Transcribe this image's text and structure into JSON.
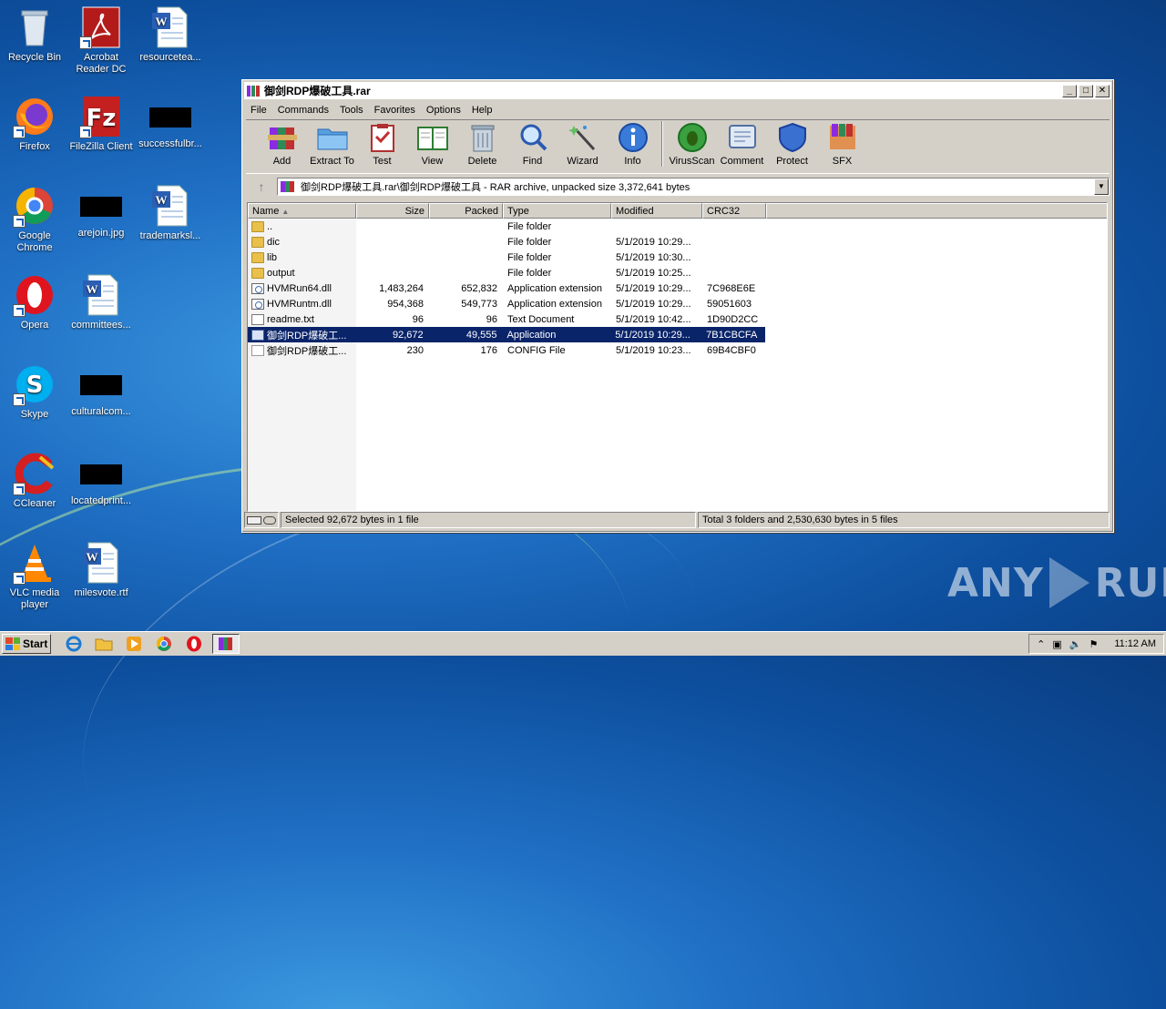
{
  "desktop": {
    "icons": [
      {
        "label": "Recycle Bin",
        "icon": "recycle-bin-icon"
      },
      {
        "label": "Acrobat Reader DC",
        "icon": "acrobat-icon"
      },
      {
        "label": "resourcetea...",
        "icon": "word-doc-icon"
      },
      {
        "label": "Firefox",
        "icon": "firefox-icon"
      },
      {
        "label": "FileZilla Client",
        "icon": "filezilla-icon"
      },
      {
        "label": "successfulbr...",
        "icon": "black-thumbnail-icon"
      },
      {
        "label": "Google Chrome",
        "icon": "chrome-icon"
      },
      {
        "label": "arejoin.jpg",
        "icon": "black-thumbnail-icon"
      },
      {
        "label": "trademarksl...",
        "icon": "word-doc-icon"
      },
      {
        "label": "Opera",
        "icon": "opera-icon"
      },
      {
        "label": "committees...",
        "icon": "word-doc-icon"
      },
      {
        "label": "Skype",
        "icon": "skype-icon"
      },
      {
        "label": "culturalcom...",
        "icon": "black-thumbnail-icon"
      },
      {
        "label": "CCleaner",
        "icon": "ccleaner-icon"
      },
      {
        "label": "locatedprint...",
        "icon": "black-thumbnail-icon"
      },
      {
        "label": "VLC media player",
        "icon": "vlc-icon"
      },
      {
        "label": "milesvote.rtf",
        "icon": "word-doc-icon"
      }
    ]
  },
  "window": {
    "title": "御剑RDP爆破工具.rar",
    "menu": [
      "File",
      "Commands",
      "Tools",
      "Favorites",
      "Options",
      "Help"
    ],
    "toolbar": [
      "Add",
      "Extract To",
      "Test",
      "View",
      "Delete",
      "Find",
      "Wizard",
      "Info",
      "VirusScan",
      "Comment",
      "Protect",
      "SFX"
    ],
    "address": "御剑RDP爆破工具.rar\\御剑RDP爆破工具 - RAR archive, unpacked size 3,372,641 bytes",
    "columns": {
      "name": "Name",
      "size": "Size",
      "packed": "Packed",
      "type": "Type",
      "modified": "Modified",
      "crc": "CRC32"
    },
    "files": [
      {
        "name": "..",
        "size": "",
        "packed": "",
        "type": "File folder",
        "modified": "",
        "crc": "",
        "kind": "folder"
      },
      {
        "name": "dic",
        "size": "",
        "packed": "",
        "type": "File folder",
        "modified": "5/1/2019 10:29...",
        "crc": "",
        "kind": "folder"
      },
      {
        "name": "lib",
        "size": "",
        "packed": "",
        "type": "File folder",
        "modified": "5/1/2019 10:30...",
        "crc": "",
        "kind": "folder"
      },
      {
        "name": "output",
        "size": "",
        "packed": "",
        "type": "File folder",
        "modified": "5/1/2019 10:25...",
        "crc": "",
        "kind": "folder"
      },
      {
        "name": "HVMRun64.dll",
        "size": "1,483,264",
        "packed": "652,832",
        "type": "Application extension",
        "modified": "5/1/2019 10:29...",
        "crc": "7C968E6E",
        "kind": "dll"
      },
      {
        "name": "HVMRuntm.dll",
        "size": "954,368",
        "packed": "549,773",
        "type": "Application extension",
        "modified": "5/1/2019 10:29...",
        "crc": "59051603",
        "kind": "dll"
      },
      {
        "name": "readme.txt",
        "size": "96",
        "packed": "96",
        "type": "Text Document",
        "modified": "5/1/2019 10:42...",
        "crc": "1D90D2CC",
        "kind": "txt"
      },
      {
        "name": "御剑RDP爆破工...",
        "size": "92,672",
        "packed": "49,555",
        "type": "Application",
        "modified": "5/1/2019 10:29...",
        "crc": "7B1CBCFA",
        "kind": "app",
        "selected": true
      },
      {
        "name": "御剑RDP爆破工...",
        "size": "230",
        "packed": "176",
        "type": "CONFIG File",
        "modified": "5/1/2019 10:23...",
        "crc": "69B4CBF0",
        "kind": "cfg"
      }
    ],
    "status_left": "Selected 92,672 bytes in 1 file",
    "status_right": "Total 3 folders and 2,530,630 bytes in 5 files"
  },
  "taskbar": {
    "start_label": "Start",
    "clock": "11:12 AM"
  },
  "watermark": {
    "left": "ANY",
    "right": "RUN"
  }
}
